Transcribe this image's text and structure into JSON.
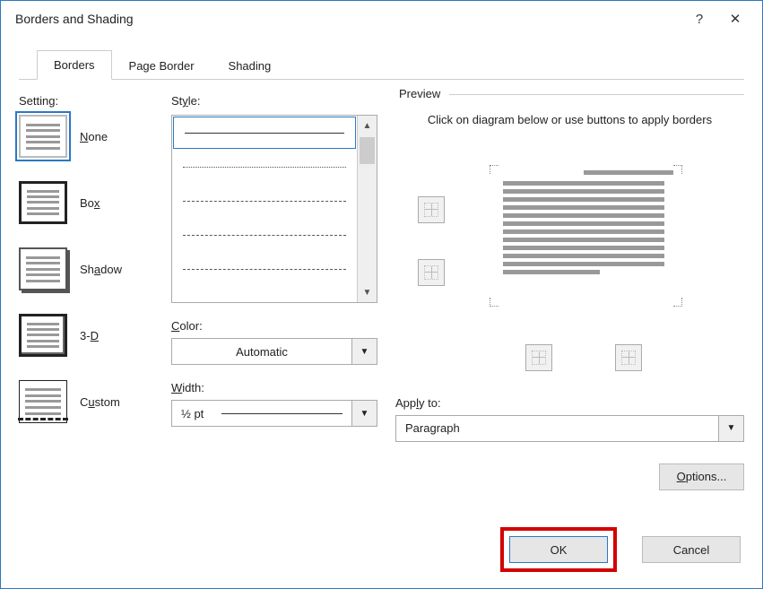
{
  "title": "Borders and Shading",
  "titlebar": {
    "help": "?",
    "close": "✕"
  },
  "tabs": {
    "borders": "Borders",
    "page_border": "Page Border",
    "shading": "Shading"
  },
  "setting": {
    "label": "Setting:",
    "none": "None",
    "box": "Box",
    "shadow": "Shadow",
    "threeD": "3-D",
    "custom": "Custom"
  },
  "style": {
    "label": "Style:",
    "color_label": "Color:",
    "color_value": "Automatic",
    "width_label": "Width:",
    "width_value": "½ pt"
  },
  "preview": {
    "legend": "Preview",
    "help": "Click on diagram below or use buttons to apply borders",
    "apply_label": "Apply to:",
    "apply_value": "Paragraph",
    "options": "Options..."
  },
  "footer": {
    "ok": "OK",
    "cancel": "Cancel"
  }
}
